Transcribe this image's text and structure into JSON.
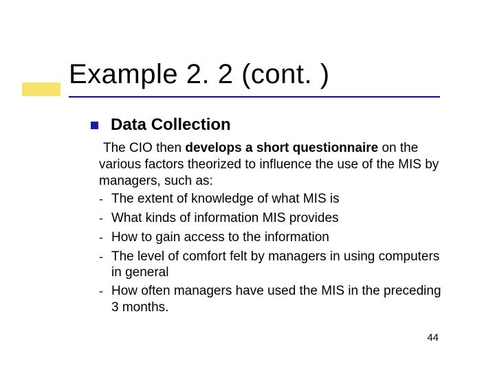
{
  "title": "Example 2. 2 (cont. )",
  "section_heading": "Data Collection",
  "intro_pre": "The CIO then ",
  "intro_bold": "develops a short questionnaire",
  "intro_post": " on the various factors theorized to influence the use of the MIS by managers, such as:",
  "items": [
    "The extent of knowledge of what MIS is",
    "What kinds of information MIS provides",
    "How to gain access to the information",
    "The level of comfort felt by managers in using computers in general",
    "How often managers have used the MIS in the preceding 3 months."
  ],
  "page_number": "44"
}
